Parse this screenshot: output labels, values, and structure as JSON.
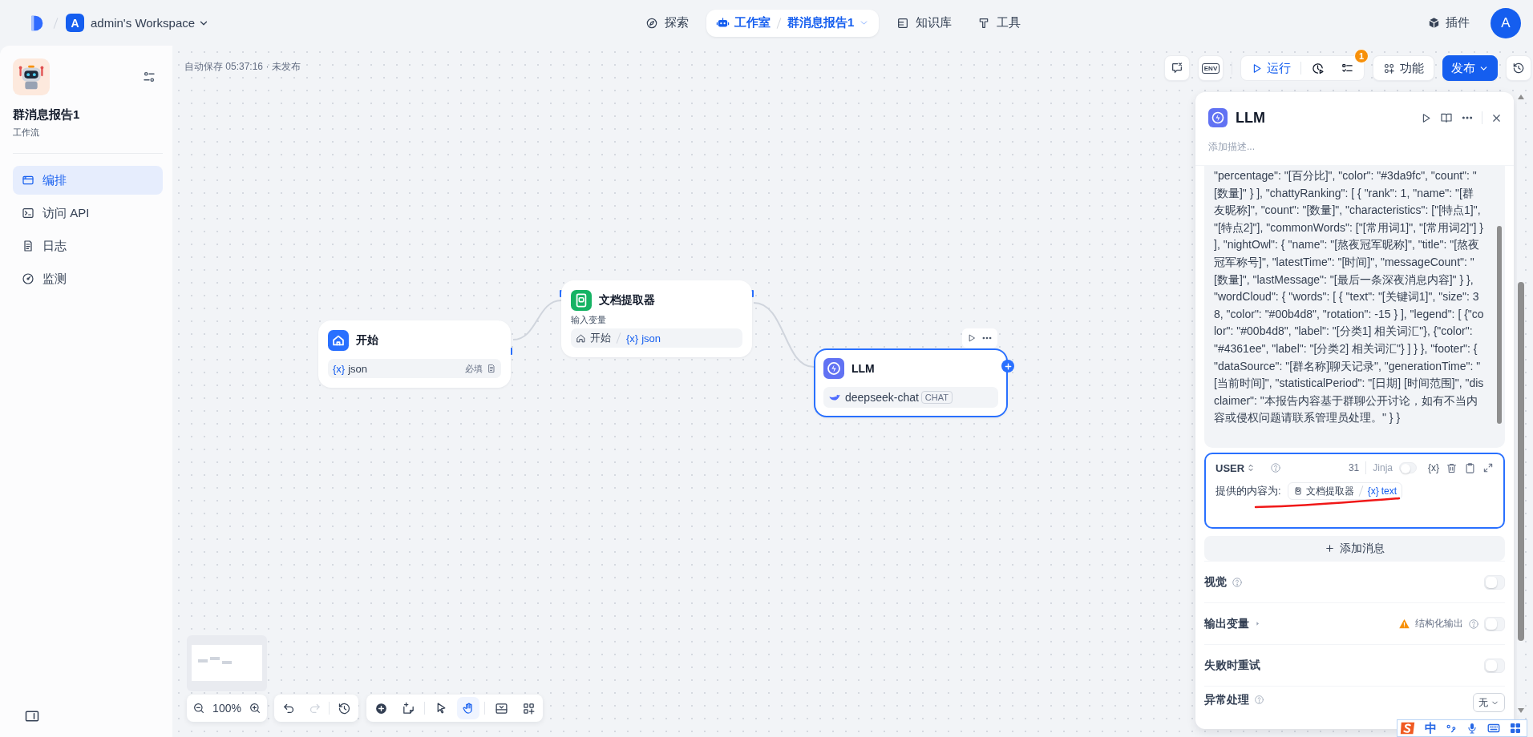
{
  "topbar": {
    "workspace_initial": "A",
    "workspace": "admin's Workspace",
    "nav": [
      {
        "kind": "explore",
        "label": "探索",
        "selected": false
      },
      {
        "kind": "studio",
        "label": "工作室",
        "app": "群消息报告1",
        "selected": true
      },
      {
        "kind": "knowledge",
        "label": "知识库",
        "selected": false
      },
      {
        "kind": "tools",
        "label": "工具",
        "selected": false
      }
    ],
    "plugins": "插件",
    "avatar": "A"
  },
  "sidebar": {
    "app_name": "群消息报告1",
    "app_type": "工作流",
    "items": [
      {
        "kind": "orchestrate",
        "label": "编排",
        "selected": true
      },
      {
        "kind": "api",
        "label": "访问 API",
        "selected": false
      },
      {
        "kind": "logs",
        "label": "日志",
        "selected": false
      },
      {
        "kind": "monitor",
        "label": "监测",
        "selected": false
      }
    ]
  },
  "canvas": {
    "autosave": "自动保存 05:37:16 · 未发布",
    "toolbar": {
      "env": "ENV",
      "run": "运行",
      "checklist_badge": "1",
      "features": "功能",
      "publish": "发布"
    },
    "nodes": [
      {
        "kind": "start",
        "title": "开始",
        "selected": false,
        "variable": {
          "prefix": "{x}",
          "name": "json",
          "required": "必填"
        }
      },
      {
        "kind": "extractor",
        "title": "文档提取器",
        "selected": false,
        "input_label": "输入变量",
        "input": {
          "node": "开始",
          "prefix": "{x}",
          "name": "json"
        }
      },
      {
        "kind": "llm",
        "title": "LLM",
        "selected": true,
        "model": "deepseek-chat",
        "mode": "CHAT"
      }
    ],
    "zoom": "100%",
    "history": [
      {
        "kind": "undo",
        "disabled": false
      },
      {
        "kind": "redo",
        "disabled": true
      },
      {
        "kind": "versions",
        "disabled": false
      }
    ],
    "tools": [
      {
        "kind": "add",
        "selected": false
      },
      {
        "kind": "note",
        "selected": false
      },
      {
        "kind": "pointer",
        "selected": false
      },
      {
        "kind": "hand",
        "selected": true
      },
      {
        "kind": "export",
        "selected": false
      },
      {
        "kind": "organize",
        "selected": false
      }
    ]
  },
  "panel": {
    "title": "LLM",
    "description_placeholder": "添加描述...",
    "prompt_text": "\"percentage\": \"[百分比]\", \"color\": \"#3da9fc\", \"count\": \"[数量]\" } ], \"chattyRanking\": [ { \"rank\": 1, \"name\": \"[群友昵称]\", \"count\": \"[数量]\", \"characteristics\": [\"[特点1]\", \"[特点2]\"], \"commonWords\": [\"[常用词1]\", \"[常用词2]\"] } ], \"nightOwl\": { \"name\": \"[熬夜冠军昵称]\", \"title\": \"[熬夜冠军称号]\", \"latestTime\": \"[时间]\", \"messageCount\": \"[数量]\", \"lastMessage\": \"[最后一条深夜消息内容]\" } }, \"wordCloud\": { \"words\": [ { \"text\": \"[关键词1]\", \"size\": 38, \"color\": \"#00b4d8\", \"rotation\": -15 } ], \"legend\": [ {\"color\": \"#00b4d8\", \"label\": \"[分类1] 相关词汇\"}, {\"color\": \"#4361ee\", \"label\": \"[分类2] 相关词汇\"} ] } }, \"footer\": { \"dataSource\": \"[群名称]聊天记录\", \"generationTime\": \"[当前时间]\", \"statisticalPeriod\": \"[日期] [时间范围]\", \"disclaimer\": \"本报告内容基于群聊公开讨论，如有不当内容或侵权问题请联系管理员处理。\" } }",
    "message": {
      "role": "USER",
      "count": "31",
      "jinja": "Jinja",
      "jinja_on": false,
      "var_button": "{x}",
      "text": "提供的内容为:",
      "ref": {
        "node": "文档提取器",
        "prefix": "{x}",
        "name": "text"
      }
    },
    "add_message": "添加消息",
    "settings": [
      {
        "kind": "toggle",
        "label": "视觉",
        "help": true,
        "on": false
      },
      {
        "kind": "output",
        "label": "输出变量",
        "note": "结构化输出",
        "on": false
      },
      {
        "kind": "toggle",
        "label": "失败时重试",
        "help": false,
        "on": false
      },
      {
        "kind": "select",
        "label": "异常处理",
        "value": "无"
      }
    ]
  },
  "ime": {
    "mode": "中"
  }
}
